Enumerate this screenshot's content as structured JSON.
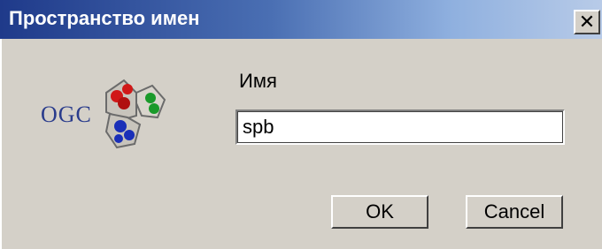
{
  "window": {
    "title": "Пространство имен",
    "close_glyph": "✕"
  },
  "logo": {
    "text": "OGC",
    "icon": "ogc-logo-icon"
  },
  "form": {
    "name_label": "Имя",
    "name_value": "spb"
  },
  "buttons": {
    "ok_label": "OK",
    "cancel_label": "Cancel"
  },
  "colors": {
    "titlebar_start": "#1f3a8a",
    "titlebar_end": "#b8cbe8",
    "face": "#d4d0c8",
    "logo_text": "#2a3c8c"
  }
}
